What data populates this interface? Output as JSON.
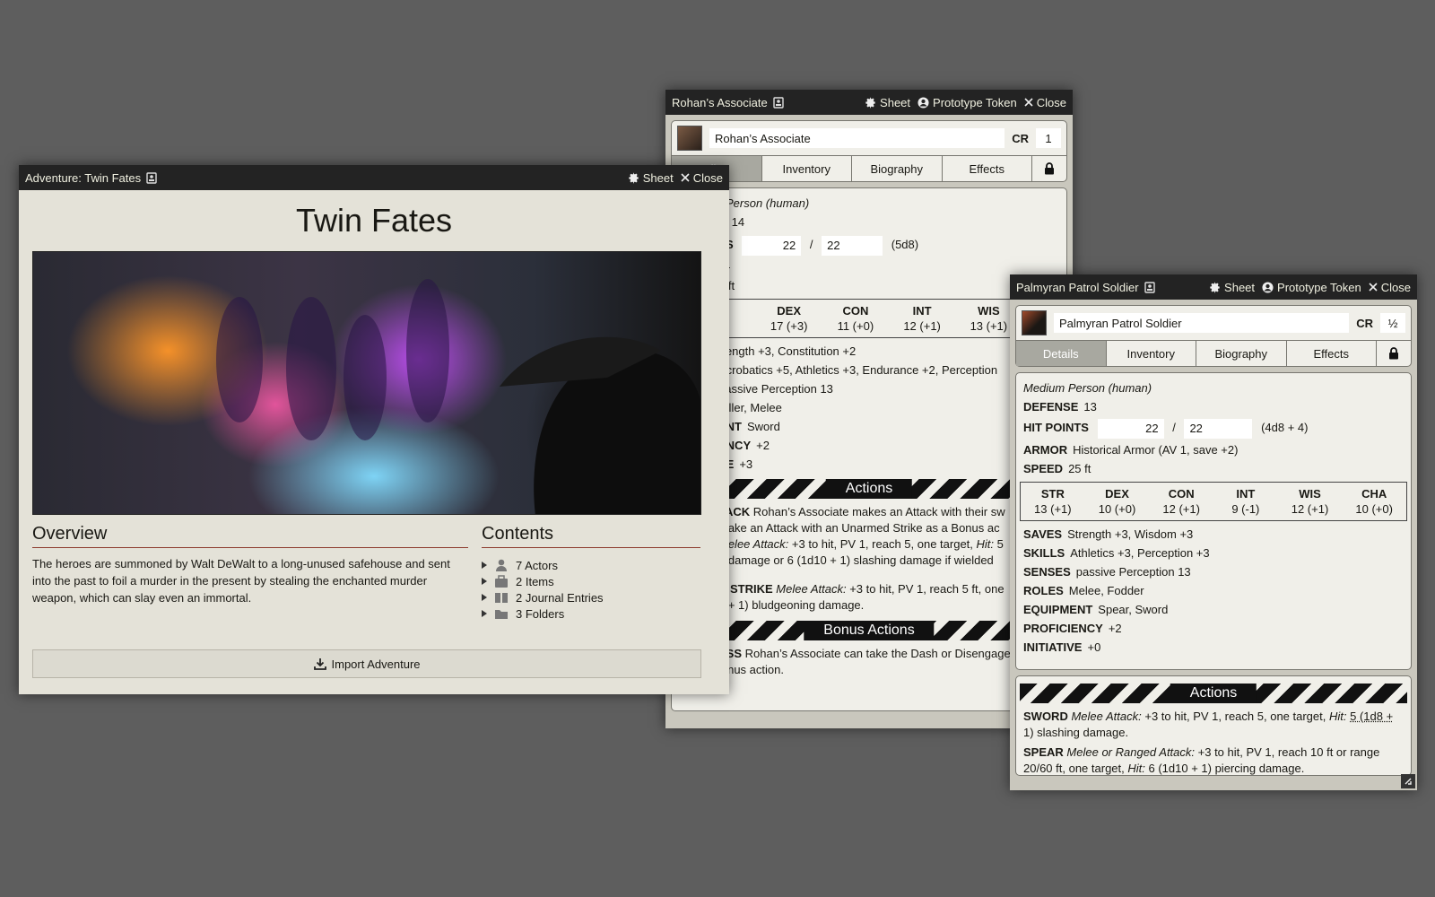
{
  "rohan": {
    "title": "Rohan’s Associate",
    "controls": {
      "sheet": "Sheet",
      "prototype": "Prototype Token",
      "close": "Close"
    },
    "name": "Rohan’s Associate",
    "cr_label": "CR",
    "cr_value": "1",
    "tabs": {
      "details": "ils",
      "inventory": "Inventory",
      "biography": "Biography",
      "effects": "Effects"
    },
    "type": "Person (human)",
    "defense_label": "E",
    "defense": "14",
    "hp_label": "TS",
    "hp_current": "22",
    "hp_sep": "/",
    "hp_max": "22",
    "hp_dice": "(5d8)",
    "dash": "—",
    "speed": "0 ft",
    "abilities": [
      {
        "name": "DEX",
        "value": "17 (+3)"
      },
      {
        "name": "CON",
        "value": "11 (+0)"
      },
      {
        "name": "INT",
        "value": "12 (+1)"
      },
      {
        "name": "WIS",
        "value": "13 (+1)"
      }
    ],
    "saves": "trength +3, Constitution +2",
    "skills": "Acrobatics +5, Athletics +3, Endurance +2, Perception",
    "senses": "passive Perception 13",
    "roles": "Killer, Melee",
    "equip_label": "ENT",
    "equip": "Sword",
    "prof_label": "ENCY",
    "prof": "+2",
    "init_label": "VE",
    "init": "+3",
    "actions_title": "Actions",
    "action1_label": "TACK",
    "action1_text": "Rohan’s Associate makes an Attack with their sw",
    "action1_line2": "make an Attack with an Unarmed Strike as a Bonus ac",
    "action2_em": "Melee Attack:",
    "action2_text": "+3 to hit, PV 1, reach 5, one target,",
    "action2_hit": "Hit:",
    "action2_tail": "5",
    "action2_line2": "g damage or 6 (1d10 + 1) slashing damage if wielded",
    "action3_label": "D STRIKE",
    "action3_em": "Melee Attack:",
    "action3_text": "+3 to hit, PV 1, reach 5 ft, one",
    "action3_line2": "6 + 1) bludgeoning damage.",
    "bonus_title": "Bonus Actions",
    "bonus_label": "ESS",
    "bonus_text": "Rohan’s Associate can take the Dash or Disengage",
    "bonus_line2": "as a Bonus action."
  },
  "adventure": {
    "title": "Adventure: Twin Fates",
    "controls": {
      "sheet": "Sheet",
      "close": "Close"
    },
    "heading": "Twin Fates",
    "overview_title": "Overview",
    "overview_text": "The heroes are summoned by Walt DeWalt to a long-unused safehouse and sent into the past to foil a murder in the present by stealing the enchanted murder weapon, which can slay even an immortal.",
    "contents_title": "Contents",
    "contents": [
      {
        "icon": "user-icon",
        "label": "7 Actors"
      },
      {
        "icon": "briefcase-icon",
        "label": "2 Items"
      },
      {
        "icon": "book-icon",
        "label": "2 Journal Entries"
      },
      {
        "icon": "folder-icon",
        "label": "3 Folders"
      }
    ],
    "import_label": "Import Adventure"
  },
  "soldier": {
    "title": "Palmyran Patrol Soldier",
    "controls": {
      "sheet": "Sheet",
      "prototype": "Prototype Token",
      "close": "Close"
    },
    "name": "Palmyran Patrol Soldier",
    "cr_label": "CR",
    "cr_value": "½",
    "tabs": {
      "details": "Details",
      "inventory": "Inventory",
      "biography": "Biography",
      "effects": "Effects"
    },
    "type": "Medium Person (human)",
    "defense_label": "DEFENSE",
    "defense": "13",
    "hp_label": "HIT POINTS",
    "hp_current": "22",
    "hp_sep": "/",
    "hp_max": "22",
    "hp_dice": "(4d8 + 4)",
    "armor_label": "ARMOR",
    "armor": "Historical Armor (AV 1, save +2)",
    "speed_label": "SPEED",
    "speed": "25 ft",
    "abilities": [
      {
        "name": "STR",
        "value": "13 (+1)"
      },
      {
        "name": "DEX",
        "value": "10 (+0)"
      },
      {
        "name": "CON",
        "value": "12 (+1)"
      },
      {
        "name": "INT",
        "value": "9 (-1)"
      },
      {
        "name": "WIS",
        "value": "12 (+1)"
      },
      {
        "name": "CHA",
        "value": "10 (+0)"
      }
    ],
    "saves_label": "SAVES",
    "saves": "Strength +3, Wisdom +3",
    "skills_label": "SKILLS",
    "skills": "Athletics +3, Perception +3",
    "senses_label": "SENSES",
    "senses": "passive Perception 13",
    "roles_label": "ROLES",
    "roles": "Melee, Fodder",
    "equip_label": "EQUIPMENT",
    "equip": "Spear, Sword",
    "prof_label": "PROFICIENCY",
    "prof": "+2",
    "init_label": "INITIATIVE",
    "init": "+0",
    "actions_title": "Actions",
    "sword_label": "SWORD",
    "sword_em": "Melee Attack:",
    "sword_text": "+3 to hit, PV 1, reach 5, one target,",
    "sword_hit": "Hit:",
    "sword_dmg": "5 (1d8 +",
    "sword_line2": "1) slashing damage.",
    "spear_label": "SPEAR",
    "spear_em": "Melee or Ranged Attack:",
    "spear_text": "+3 to hit, PV 1, reach 10 ft or range",
    "spear_line2a": "20/60 ft, one target,",
    "spear_hit": "Hit:",
    "spear_line2b": "6 (1d10 + 1) piercing damage."
  }
}
